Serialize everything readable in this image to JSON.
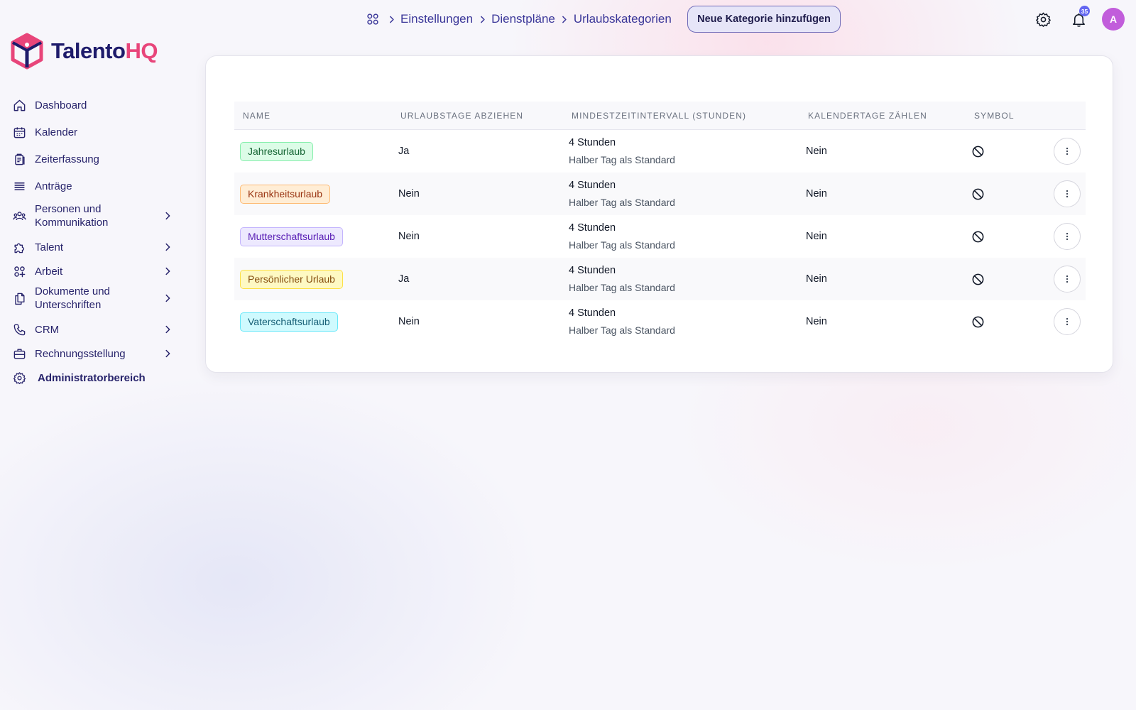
{
  "brand": {
    "name_part1": "Talento",
    "name_part2": "HQ",
    "color_primary": "#1e1b6b",
    "color_accent": "#e8457a"
  },
  "sidebar": {
    "items": [
      {
        "label": "Dashboard",
        "icon": "home-icon",
        "has_submenu": false
      },
      {
        "label": "Kalender",
        "icon": "calendar-icon",
        "has_submenu": false
      },
      {
        "label": "Zeiterfassung",
        "icon": "clipboard-icon",
        "has_submenu": false
      },
      {
        "label": "Anträge",
        "icon": "stack-icon",
        "has_submenu": false
      },
      {
        "label": "Personen und Kommunikation",
        "icon": "people-icon",
        "has_submenu": true
      },
      {
        "label": "Talent",
        "icon": "puzzle-icon",
        "has_submenu": true
      },
      {
        "label": "Arbeit",
        "icon": "apps-add-icon",
        "has_submenu": true
      },
      {
        "label": "Dokumente und Unterschriften",
        "icon": "documents-icon",
        "has_submenu": true
      },
      {
        "label": "CRM",
        "icon": "phone-icon",
        "has_submenu": true
      },
      {
        "label": "Rechnungsstellung",
        "icon": "briefcase-icon",
        "has_submenu": true
      },
      {
        "label": "Administratorbereich",
        "icon": "gear-icon",
        "has_submenu": false
      }
    ]
  },
  "breadcrumb": {
    "home_icon": "grid-icon",
    "items": [
      "Einstellungen",
      "Dienstpläne",
      "Urlaubskategorien"
    ]
  },
  "header": {
    "add_button_label": "Neue Kategorie hinzufügen",
    "settings_icon": "gear-icon",
    "notifications_icon": "bell-icon",
    "notification_count": "35",
    "avatar_initial": "A",
    "avatar_color": "#c15ddb"
  },
  "table": {
    "columns": [
      "Name",
      "Urlaubstage abziehen",
      "Mindestzeitintervall (Stunden)",
      "Kalendertage zählen",
      "Symbol"
    ],
    "rows": [
      {
        "name": "Jahresurlaub",
        "badge_bg": "#dcfce7",
        "badge_border": "#86efac",
        "badge_text": "#166534",
        "deduct": "Ja",
        "interval": "4 Stunden",
        "interval_note": "Halber Tag als Standard",
        "calendar_days": "Nein",
        "symbol_icon": "ban-icon"
      },
      {
        "name": "Krankheitsurlaub",
        "badge_bg": "#ffedd5",
        "badge_border": "#fdba74",
        "badge_text": "#9a3412",
        "deduct": "Nein",
        "interval": "4 Stunden",
        "interval_note": "Halber Tag als Standard",
        "calendar_days": "Nein",
        "symbol_icon": "ban-icon"
      },
      {
        "name": "Mutterschaftsurlaub",
        "badge_bg": "#ede9fe",
        "badge_border": "#c4b5fd",
        "badge_text": "#5b21b6",
        "deduct": "Nein",
        "interval": "4 Stunden",
        "interval_note": "Halber Tag als Standard",
        "calendar_days": "Nein",
        "symbol_icon": "ban-icon"
      },
      {
        "name": "Persönlicher Urlaub",
        "badge_bg": "#fef9c3",
        "badge_border": "#fde047",
        "badge_text": "#854d0e",
        "deduct": "Ja",
        "interval": "4 Stunden",
        "interval_note": "Halber Tag als Standard",
        "calendar_days": "Nein",
        "symbol_icon": "ban-icon"
      },
      {
        "name": "Vaterschaftsurlaub",
        "badge_bg": "#cffafe",
        "badge_border": "#67e8f9",
        "badge_text": "#155e75",
        "deduct": "Nein",
        "interval": "4 Stunden",
        "interval_note": "Halber Tag als Standard",
        "calendar_days": "Nein",
        "symbol_icon": "ban-icon"
      }
    ],
    "row_action_icon": "more-vertical-icon"
  }
}
